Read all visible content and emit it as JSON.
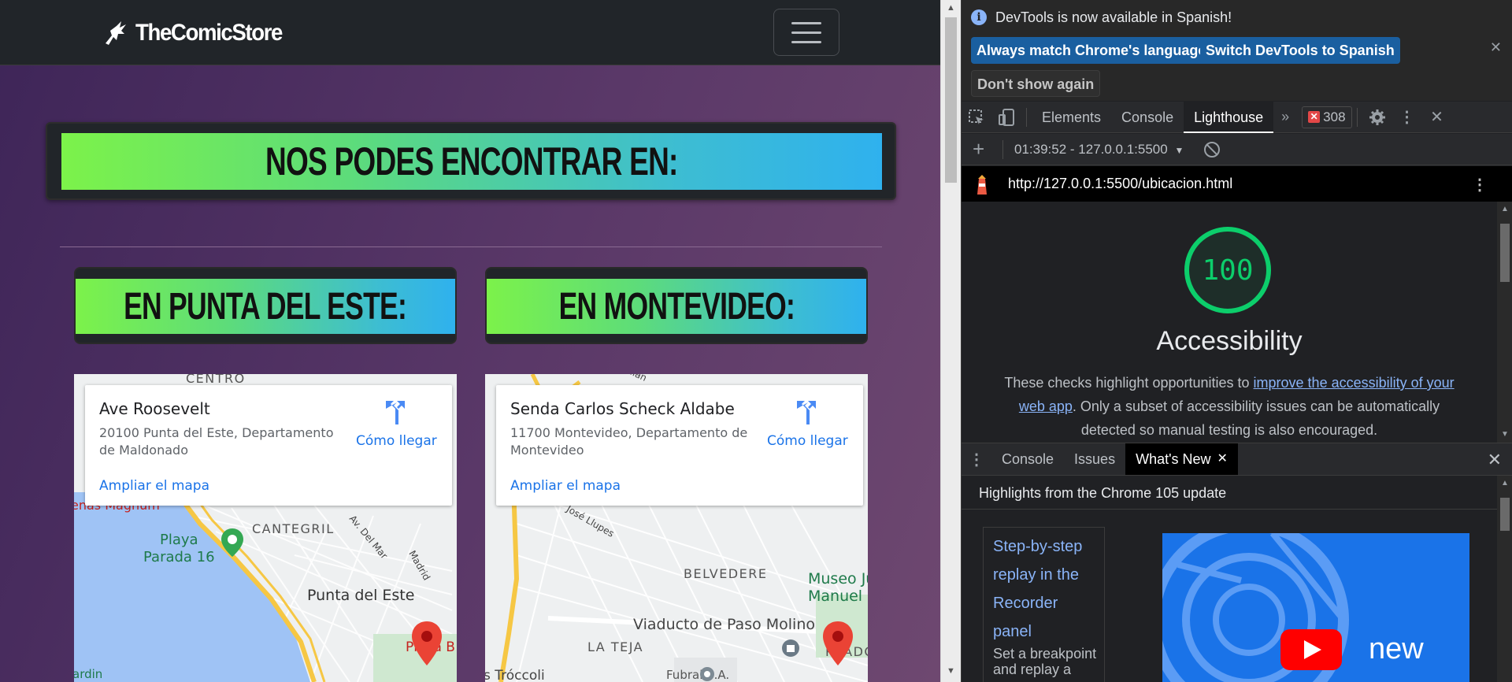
{
  "site": {
    "brand": "TheComicStore",
    "hero_title": "NOS PODES ENCONTRAR EN:",
    "cities": [
      {
        "heading": "EN PUNTA DEL ESTE:",
        "map": {
          "place": "Ave Roosevelt",
          "address": "20100 Punta del Este, Departamento de Maldonado",
          "directions": "Cómo llegar",
          "enlarge": "Ampliar el mapa",
          "labels": {
            "centro": "CENTRO",
            "cantegril": "CANTEGRIL",
            "playa_parada": "Playa\nParada 16",
            "punta_del_este": "Punta del Este",
            "playa_b": "Playa B",
            "av_del_mar": "Av. Del Mar",
            "madrid": "Madrid",
            "magnum": "enas Magnum",
            "ardin": "ardin"
          }
        }
      },
      {
        "heading": "EN MONTEVIDEO:",
        "map": {
          "place": "Senda Carlos Scheck Aldabe",
          "address": "11700 Montevideo, Departamento de Montevideo",
          "directions": "Cómo llegar",
          "enlarge": "Ampliar el mapa",
          "labels": {
            "belvedere": "BELVEDERE",
            "museo": "Museo Ju\nManuel Blan",
            "viaducto": "Viaducto de Paso Molino",
            "la_teja": "LA TEJA",
            "prado": "PRADO",
            "fubral": "Fubral S.A.",
            "troccoli": "s Tróccoli",
            "jose_llupes": "José Llupes",
            "milan": "ilan"
          }
        }
      }
    ]
  },
  "devtools": {
    "infobar": {
      "message": "DevTools is now available in Spanish!",
      "btn_match": "Always match Chrome's language",
      "btn_switch": "Switch DevTools to Spanish",
      "btn_dont_show": "Don't show again"
    },
    "tabs": [
      "Elements",
      "Console",
      "Lighthouse"
    ],
    "active_tab": "Lighthouse",
    "error_count": "308",
    "lighthouse": {
      "session": "01:39:52 - 127.0.0.1:5500",
      "url": "http://127.0.0.1:5500/ubicacion.html",
      "score": "100",
      "category": "Accessibility",
      "desc_before": "These checks highlight opportunities to ",
      "desc_link": "improve the accessibility of your web app",
      "desc_after": ". Only a subset of accessibility issues can be automatically detected so manual testing is also encouraged."
    },
    "drawer": {
      "tabs": [
        "Console",
        "Issues"
      ],
      "active_tab": "What's New",
      "heading": "Highlights from the Chrome 105 update",
      "card_title": "Step-by-step replay in the Recorder panel",
      "card_desc": "Set a breakpoint and replay a",
      "video_text": "new"
    }
  },
  "colors": {
    "gradient_start": "#7cf24a",
    "gradient_end": "#2fb1ee",
    "score_green": "#0cce6b",
    "link_blue": "#1a73e8"
  }
}
